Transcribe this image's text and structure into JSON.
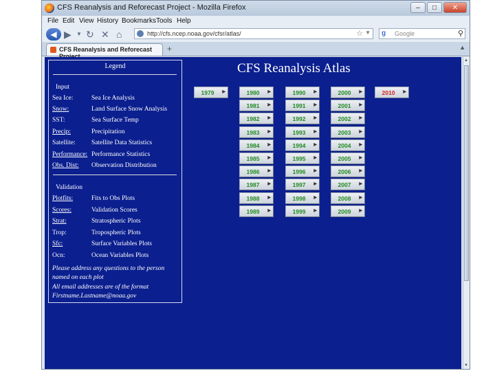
{
  "window": {
    "title": "CFS Reanalysis and Reforecast Project - Mozilla Firefox",
    "controls": [
      "–",
      "□",
      "✕"
    ]
  },
  "menu": [
    "File",
    "Edit",
    "View",
    "History",
    "Bookmarks",
    "Tools",
    "Help"
  ],
  "nav": {
    "url": "http://cfs.ncep.noaa.gov/cfsr/atlas/",
    "search_placeholder": "Google"
  },
  "tab": {
    "label": "CFS Reanalysis and Reforecast Project",
    "new_tab": "+"
  },
  "page": {
    "title": "CFS Reanalysis Atlas",
    "legend": {
      "title": "Legend",
      "input_heading": "Input",
      "input_items": [
        {
          "key": "Sea Ice:",
          "value": "Sea Ice Analysis",
          "link": false
        },
        {
          "key": "Snow:",
          "value": "Land Surface Snow Analysis",
          "link": true
        },
        {
          "key": "SST:",
          "value": "Sea Surface Temp",
          "link": false
        },
        {
          "key": "Precip:",
          "value": "Precipitation",
          "link": true
        },
        {
          "key": "Satellite:",
          "value": "Satellite Data Statistics",
          "link": false
        },
        {
          "key": "Performance:",
          "value": "Performance Statistics",
          "link": true
        },
        {
          "key": "Obs. Dist:",
          "value": "Observation Distribution",
          "link": true
        }
      ],
      "validation_heading": "Validation",
      "validation_items": [
        {
          "key": "Plotfits:",
          "value": "Fits to Obs Plots",
          "link": true
        },
        {
          "key": "Scores:",
          "value": "Validation Scores",
          "link": true
        },
        {
          "key": "Strat:",
          "value": "Stratospheric Plots",
          "link": true
        },
        {
          "key": "Trop:",
          "value": "Tropospheric Plots",
          "link": false
        },
        {
          "key": "Sfc:",
          "value": "Surface Variables Plots",
          "link": true
        },
        {
          "key": "Ocn:",
          "value": "Ocean Variables Plots",
          "link": false
        }
      ],
      "notes": [
        "Please address any questions to the person",
        "named on each plot",
        "All email addresses are of the format",
        "Firstname.Lastname@noaa.gov"
      ]
    },
    "year_buttons": [
      {
        "label": "1979",
        "col": 0,
        "row": 0,
        "color": "green"
      },
      {
        "label": "1980",
        "col": 1,
        "row": 0,
        "color": "green"
      },
      {
        "label": "1981",
        "col": 1,
        "row": 1,
        "color": "green"
      },
      {
        "label": "1982",
        "col": 1,
        "row": 2,
        "color": "green"
      },
      {
        "label": "1983",
        "col": 1,
        "row": 3,
        "color": "green"
      },
      {
        "label": "1984",
        "col": 1,
        "row": 4,
        "color": "green"
      },
      {
        "label": "1985",
        "col": 1,
        "row": 5,
        "color": "green"
      },
      {
        "label": "1986",
        "col": 1,
        "row": 6,
        "color": "green"
      },
      {
        "label": "1987",
        "col": 1,
        "row": 7,
        "color": "green"
      },
      {
        "label": "1988",
        "col": 1,
        "row": 8,
        "color": "green"
      },
      {
        "label": "1989",
        "col": 1,
        "row": 9,
        "color": "green"
      },
      {
        "label": "1990",
        "col": 2,
        "row": 0,
        "color": "green"
      },
      {
        "label": "1991",
        "col": 2,
        "row": 1,
        "color": "green"
      },
      {
        "label": "1992",
        "col": 2,
        "row": 2,
        "color": "green"
      },
      {
        "label": "1993",
        "col": 2,
        "row": 3,
        "color": "green"
      },
      {
        "label": "1994",
        "col": 2,
        "row": 4,
        "color": "green"
      },
      {
        "label": "1995",
        "col": 2,
        "row": 5,
        "color": "green"
      },
      {
        "label": "1996",
        "col": 2,
        "row": 6,
        "color": "green"
      },
      {
        "label": "1997",
        "col": 2,
        "row": 7,
        "color": "green"
      },
      {
        "label": "1998",
        "col": 2,
        "row": 8,
        "color": "green"
      },
      {
        "label": "1999",
        "col": 2,
        "row": 9,
        "color": "green"
      },
      {
        "label": "2000",
        "col": 3,
        "row": 0,
        "color": "green"
      },
      {
        "label": "2001",
        "col": 3,
        "row": 1,
        "color": "green"
      },
      {
        "label": "2002",
        "col": 3,
        "row": 2,
        "color": "green"
      },
      {
        "label": "2003",
        "col": 3,
        "row": 3,
        "color": "green"
      },
      {
        "label": "2004",
        "col": 3,
        "row": 4,
        "color": "green"
      },
      {
        "label": "2005",
        "col": 3,
        "row": 5,
        "color": "green"
      },
      {
        "label": "2006",
        "col": 3,
        "row": 6,
        "color": "green"
      },
      {
        "label": "2007",
        "col": 3,
        "row": 7,
        "color": "green"
      },
      {
        "label": "2008",
        "col": 3,
        "row": 8,
        "color": "green"
      },
      {
        "label": "2009",
        "col": 3,
        "row": 9,
        "color": "green"
      },
      {
        "label": "2010",
        "col": 4,
        "row": 0,
        "color": "red"
      }
    ]
  },
  "colors": {
    "page_bg": "#0b1f8f",
    "year_green": "#1f8a1f",
    "year_red": "#d0251c"
  }
}
